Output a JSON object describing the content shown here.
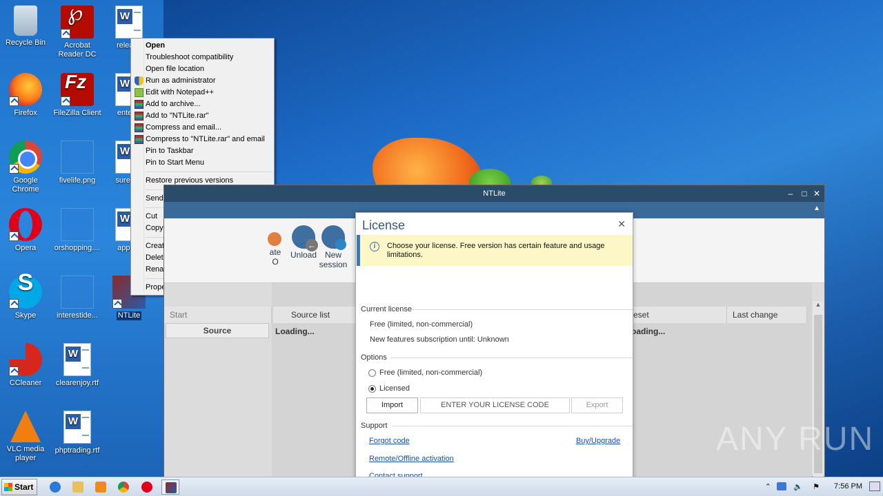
{
  "desktop": {
    "icons": [
      {
        "label": "Recycle Bin"
      },
      {
        "label": "Acrobat Reader DC"
      },
      {
        "label": "release"
      },
      {
        "label": "Firefox"
      },
      {
        "label": "FileZilla Client"
      },
      {
        "label": "enterm"
      },
      {
        "label": "Google Chrome"
      },
      {
        "label": "fivelife.png"
      },
      {
        "label": "suredev"
      },
      {
        "label": "Opera"
      },
      {
        "label": "orshopping...."
      },
      {
        "label": "approv"
      },
      {
        "label": "Skype"
      },
      {
        "label": "interestide..."
      },
      {
        "label": "NTLite"
      },
      {
        "label": "CCleaner"
      },
      {
        "label": "clearenjoy.rtf"
      },
      {
        "label": "VLC media player"
      },
      {
        "label": "phptrading.rtf"
      }
    ]
  },
  "context_menu": {
    "items": [
      "Open",
      "Troubleshoot compatibility",
      "Open file location",
      "Run as administrator",
      "Edit with Notepad++",
      "Add to archive...",
      "Add to \"NTLite.rar\"",
      "Compress and email...",
      "Compress to \"NTLite.rar\" and email",
      "Pin to Taskbar",
      "Pin to Start Menu",
      "Restore previous versions",
      "Send to",
      "Cut",
      "Copy",
      "Create shortcut",
      "Delete",
      "Rename",
      "Properties"
    ]
  },
  "ntlite": {
    "title": "NTLite",
    "ribbon": {
      "iso_label": "ate",
      "iso_label2": "O",
      "unload": "Unload",
      "new_session_1": "New",
      "new_session_2": "session"
    },
    "left_header": "Start",
    "left_item": "Source",
    "columns": {
      "source_list": "Source list",
      "preset": "eset",
      "last_change": "Last change"
    },
    "loading": "Loading...",
    "loading2": "oading..."
  },
  "license": {
    "title": "License",
    "info": "Choose your license. Free version has certain feature and usage limitations.",
    "current_license_title": "Current license",
    "current_value": "Free (limited, non-commercial)",
    "subscription": "New features subscription until: Unknown",
    "options_title": "Options",
    "option_free": "Free (limited, non-commercial)",
    "option_licensed": "Licensed",
    "import": "Import",
    "code_placeholder": "ENTER YOUR LICENSE CODE",
    "export": "Export",
    "support_title": "Support",
    "forgot_code": "Forgot code",
    "buy_upgrade": "Buy/Upgrade",
    "remote_activation": "Remote/Offline activation",
    "contact_support": "Contact support"
  },
  "watermark": "ANY RUN",
  "taskbar": {
    "start": "Start",
    "clock": "7:56 PM"
  },
  "colors": {
    "ntlite_title": "#2b4b6b",
    "info_bar": "#fdf7c8",
    "link": "#1a4fa8"
  }
}
